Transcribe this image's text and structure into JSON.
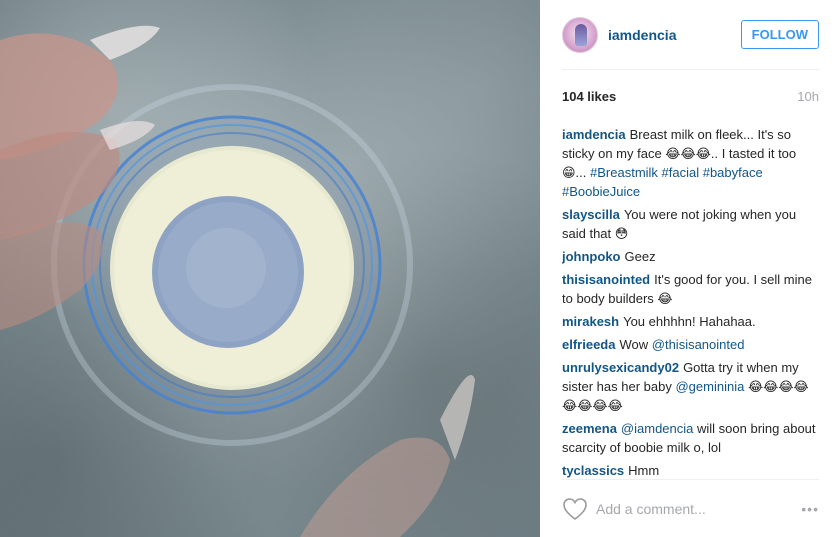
{
  "post": {
    "username": "iamdencia",
    "follow_label": "FOLLOW",
    "likes": "104 likes",
    "time": "10h"
  },
  "caption": {
    "user": "iamdencia",
    "text": "Breast milk on fleek... It's so sticky on my face 😂😂😂.. I tasted it too 😁...",
    "tags": "#Breastmilk #facial #babyface #BoobieJuice"
  },
  "comments": [
    {
      "user": "slayscilla",
      "text": "You were not joking when you said that 😳"
    },
    {
      "user": "johnpoko",
      "text": "Geez"
    },
    {
      "user": "thisisanointed",
      "text": "It's good for you. I sell mine to body builders 😂"
    },
    {
      "user": "mirakesh",
      "text": "You ehhhhn! Hahahaa."
    },
    {
      "user": "elfrieeda",
      "text": "Wow",
      "mention": "@thisisanointed"
    },
    {
      "user": "unrulysexicandy02",
      "text": "Gotta try it when my sister has her baby",
      "mention": "@gemininia",
      "after": "😂😂😂😂😂😂😂😂"
    },
    {
      "user": "zeemena",
      "mention": "@iamdencia",
      "text": "will soon bring about scarcity of boobie milk o, lol"
    },
    {
      "user": "tyclassics",
      "text": "Hmm"
    }
  ],
  "footer": {
    "add_comment_placeholder": "Add a comment...",
    "more_label": "•••"
  },
  "icons": {
    "avatar": "avatar-image",
    "like": "heart-icon",
    "more": "more-options-icon"
  },
  "colors": {
    "link": "#125688",
    "follow_blue": "#3897f0",
    "muted": "#a5a7aa"
  }
}
